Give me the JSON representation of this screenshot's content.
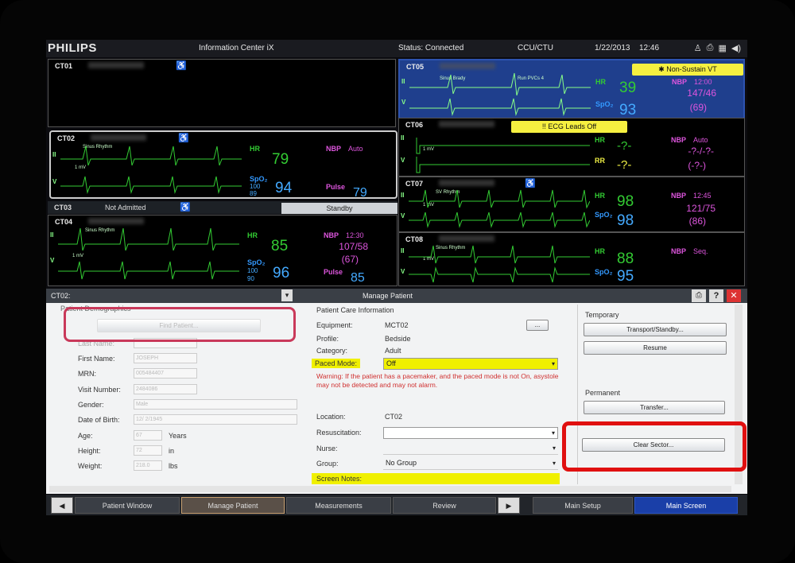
{
  "topbar": {
    "brand": "PHILIPS",
    "app_title": "Information Center iX",
    "status": "Status: Connected",
    "unit": "CCU/CTU",
    "date": "1/22/2013",
    "time": "12:46"
  },
  "beds": {
    "ct01": {
      "label": "CT01"
    },
    "ct02": {
      "label": "CT02",
      "rhythm": "Sinus Rhythm",
      "scale": "1 mV",
      "lead1": "II",
      "lead2": "V",
      "hr_label": "HR",
      "hr": "79",
      "spo2_label": "SpO₂",
      "spo2": "94",
      "spo2_hi": "100",
      "spo2_lo": "89",
      "nbp_label": "NBP",
      "nbp_mode": "Auto",
      "pulse_label": "Pulse",
      "pulse": "79"
    },
    "ct03": {
      "label": "CT03",
      "status": "Not Admitted",
      "standby": "Standby"
    },
    "ct04": {
      "label": "CT04",
      "rhythm": "Sinus Rhythm",
      "scale": "1 mV",
      "lead1": "II",
      "lead2": "V",
      "hr_label": "HR",
      "hr": "85",
      "spo2_label": "SpO₂",
      "spo2": "96",
      "spo2_hi": "100",
      "spo2_lo": "90",
      "nbp_label": "NBP",
      "nbp_time": "12:30",
      "nbp": "107/58",
      "nbp_mean": "(67)",
      "pulse_label": "Pulse",
      "pulse": "85"
    },
    "ct05": {
      "label": "CT05",
      "rhythm": "Sinus Brady",
      "rhythm2": "Run PVCs 4",
      "lead1": "II",
      "lead2": "V",
      "hr_label": "HR",
      "hr": "39",
      "spo2_label": "SpO₂",
      "spo2": "93",
      "nbp_label": "NBP",
      "nbp_time": "12:00",
      "nbp": "147/46",
      "nbp_mean": "(69)",
      "alarm": "✱ Non-Sustain VT"
    },
    "ct06": {
      "label": "CT06",
      "scale": "1 mV",
      "lead1": "II",
      "lead2": "V",
      "hr_label": "HR",
      "hr": "-?-",
      "rr_label": "RR",
      "rr": "-?-",
      "nbp_label": "NBP",
      "nbp_mode": "Auto",
      "nbp": "-?-/-?-",
      "nbp_mean": "(-?-)",
      "alarm": "!! ECG Leads Off"
    },
    "ct07": {
      "label": "CT07",
      "rhythm": "SV Rhythm",
      "scale": "1 mV",
      "lead1": "II",
      "lead2": "V",
      "hr_label": "HR",
      "hr": "98",
      "spo2_label": "SpO₂",
      "spo2": "98",
      "nbp_label": "NBP",
      "nbp_time": "12:45",
      "nbp": "121/75",
      "nbp_mean": "(86)"
    },
    "ct08": {
      "label": "CT08",
      "rhythm": "Sinus Rhythm",
      "scale": "1 mV",
      "lead1": "II",
      "lead2": "V",
      "hr_label": "HR",
      "hr": "88",
      "spo2_label": "SpO₂",
      "spo2": "95",
      "nbp_label": "NBP",
      "nbp_mode": "Seq."
    }
  },
  "panel": {
    "selected_bed": "CT02:",
    "title": "Manage Patient",
    "demographics": {
      "header": "Patient Demographics",
      "find_patient": "Find Patient...",
      "last_name_label": "Last Name:",
      "first_name_label": "First Name:",
      "first_name": "JOSEPH",
      "mrn_label": "MRN:",
      "mrn": "005484407",
      "visit_label": "Visit Number:",
      "visit": "2484086",
      "gender_label": "Gender:",
      "gender": "Male",
      "dob_label": "Date of Birth:",
      "dob": "12/ 2/1945",
      "age_label": "Age:",
      "age": "67",
      "age_unit": "Years",
      "height_label": "Height:",
      "height": "72",
      "height_unit": "in",
      "weight_label": "Weight:",
      "weight": "218.0",
      "weight_unit": "lbs"
    },
    "care": {
      "header": "Patient Care Information",
      "equipment_label": "Equipment:",
      "equipment": "MCT02",
      "equip_btn": "...",
      "profile_label": "Profile:",
      "profile": "Bedside",
      "category_label": "Category:",
      "category": "Adult",
      "paced_label": "Paced Mode:",
      "paced": "Off",
      "warning": "Warning: If the patient has a pacemaker, and the paced mode is not On, asystole may not be detected and may not alarm.",
      "location_label": "Location:",
      "location": "CT02",
      "resus_label": "Resuscitation:",
      "resus": "",
      "nurse_label": "Nurse:",
      "nurse": "",
      "group_label": "Group:",
      "group": "No Group",
      "notes_label": "Screen Notes:"
    },
    "temporary": {
      "header": "Temporary",
      "transport": "Transport/Standby...",
      "resume": "Resume"
    },
    "permanent": {
      "header": "Permanent",
      "transfer": "Transfer...",
      "clear": "Clear Sector..."
    }
  },
  "nav": {
    "patient_window": "Patient Window",
    "manage_patient": "Manage Patient",
    "measurements": "Measurements",
    "review": "Review",
    "main_setup": "Main Setup",
    "main_screen": "Main Screen"
  },
  "colors": {
    "hr": "#33cc33",
    "spo2": "#44aaff",
    "nbp": "#dd55dd",
    "alarm": "#f6f040",
    "highlight": "#e01010"
  }
}
